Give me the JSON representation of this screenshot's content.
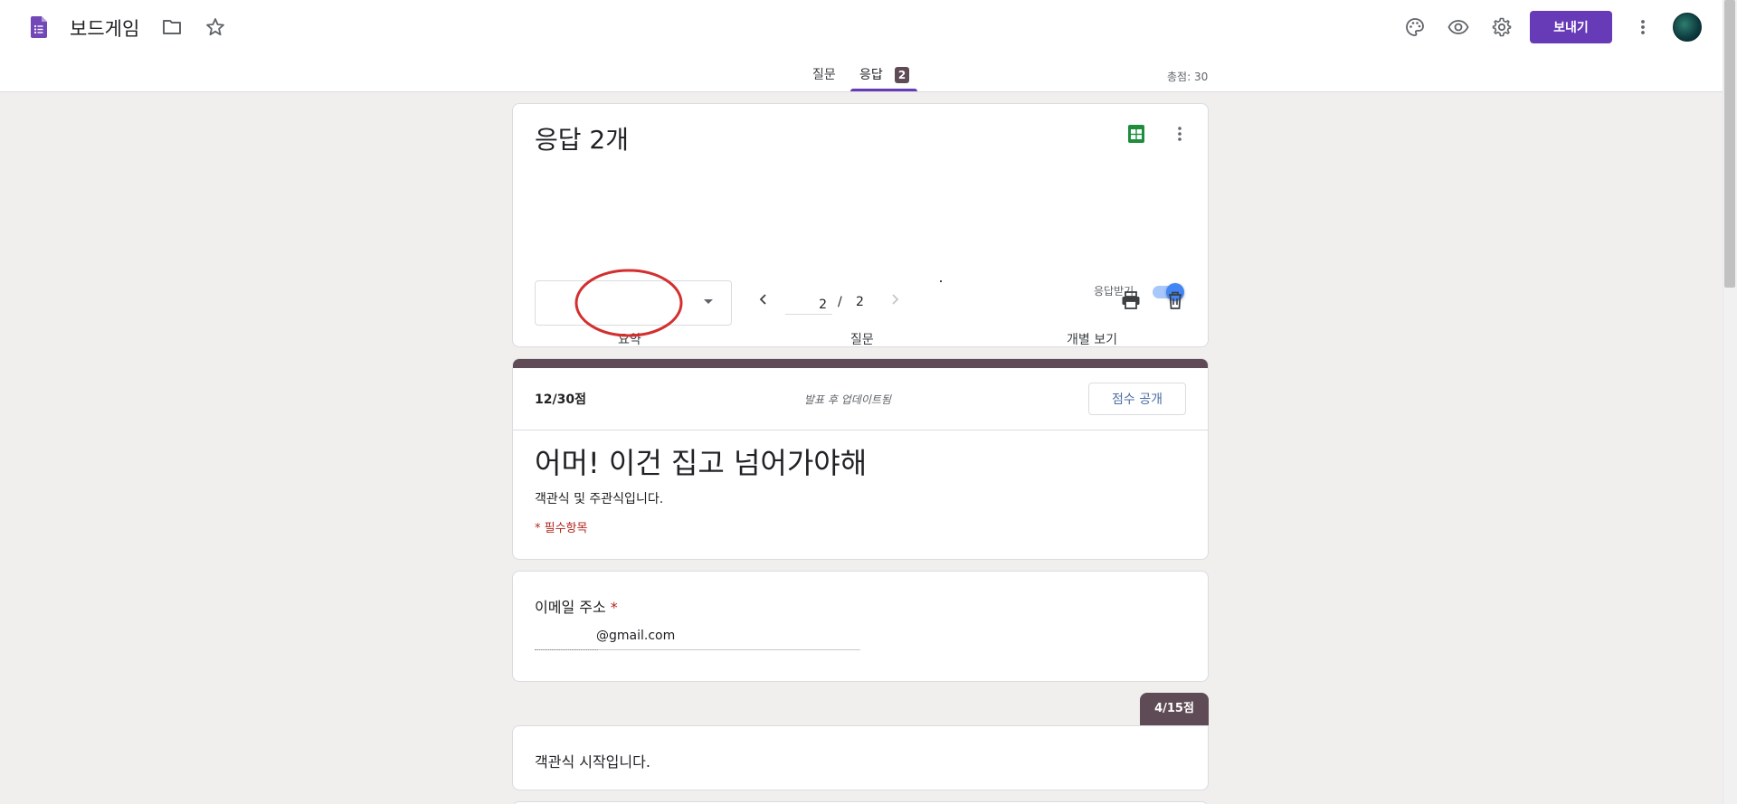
{
  "app": {
    "doc_title": "보드게임",
    "send_label": "보내기"
  },
  "top_tabs": [
    {
      "label": "질문"
    },
    {
      "label": "응답"
    }
  ],
  "response_count_badge": "2",
  "total_points": "총점: 30",
  "responses": {
    "title": "응답 2개",
    "accepting_label": "응답받기",
    "accepting": true,
    "sub_tabs": [
      {
        "label": "요약"
      },
      {
        "label": "질문"
      },
      {
        "label": "개별 보기"
      }
    ],
    "selected_respondent": "",
    "current_page": "2",
    "page_separator": "/",
    "total_pages": "2"
  },
  "header": {
    "score": "12/30점",
    "release_note": "발표 후 업데이트됨",
    "release_button": "점수 공개",
    "form_title": "어머! 이건 집고 넘어가야해",
    "form_description": "객관식 및 주관식입니다.",
    "required_note": "* 필수항목"
  },
  "email_question": {
    "label": "이메일 주소",
    "required_mark": "*",
    "value": "@gmail.com"
  },
  "section": {
    "score_badge": "4/15점",
    "description": "객관식 시작입니다."
  },
  "colors": {
    "accent": "#673ab7",
    "theme": "#5f4b56",
    "required": "#b3261e",
    "toggle": "#4285f4",
    "annotation": "#d32f2f"
  },
  "icons": [
    "forms-doc-icon",
    "folder-icon",
    "star-icon",
    "palette-icon",
    "eye-icon",
    "gear-icon",
    "more-vert-icon",
    "sheets-icon",
    "chevron-left-icon",
    "chevron-right-icon",
    "print-icon",
    "trash-icon",
    "dropdown-caret-icon"
  ]
}
